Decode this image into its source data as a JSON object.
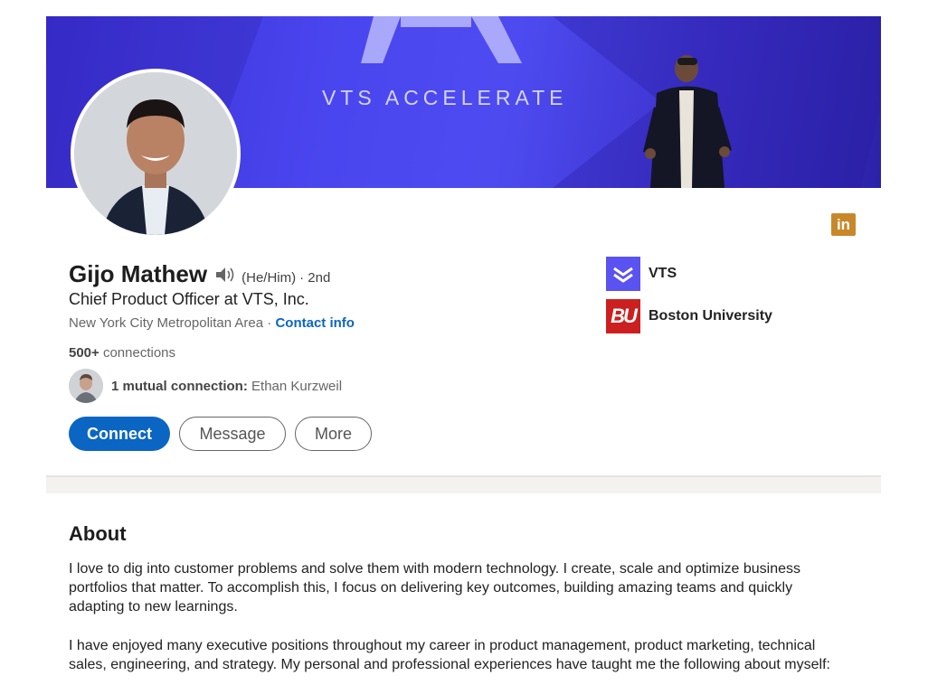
{
  "banner": {
    "text": "VTS ACCELERATE",
    "colors": {
      "primary": "#4a46ef",
      "dark": "#2c22a8"
    }
  },
  "profile": {
    "name": "Gijo Mathew",
    "pronouns": "(He/Him)",
    "degree": "· 2nd",
    "headline": "Chief Product Officer at VTS, Inc.",
    "location": "New York City Metropolitan Area",
    "location_separator": " · ",
    "contact_info": "Contact info",
    "connections_count": "500+",
    "connections_label": "connections",
    "mutual": {
      "label": "1 mutual connection:",
      "name": "Ethan Kurzweil"
    }
  },
  "actions": {
    "connect": "Connect",
    "message": "Message",
    "more": "More"
  },
  "organizations": [
    {
      "name": "VTS",
      "logo_icon": "vts-logo-icon"
    },
    {
      "name": "Boston University",
      "logo_text": "BU"
    }
  ],
  "linkedin_badge": "in",
  "about": {
    "title": "About",
    "paragraph1": "I love to dig into customer problems and solve them with modern technology. I create, scale and optimize business portfolios that matter. To accomplish this, I focus on delivering key outcomes, building amazing teams and quickly adapting to new learnings.",
    "paragraph2": "I have enjoyed many executive positions throughout my career in product management, product marketing, technical sales, engineering, and strategy. My personal and professional experiences have taught me the following about myself:"
  },
  "accent_color": "#0a66c2"
}
